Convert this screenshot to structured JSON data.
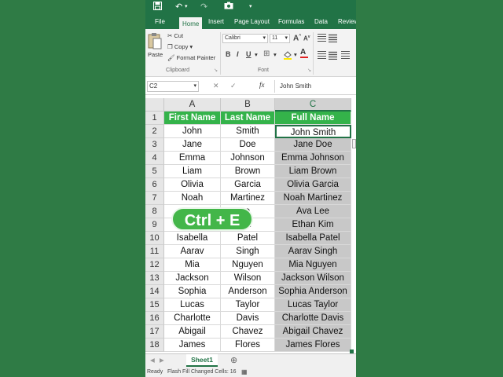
{
  "quick_access": {
    "save_icon": "save-icon",
    "undo_icon": "undo-icon",
    "redo_icon": "redo-icon",
    "camera_icon": "camera-icon"
  },
  "tabs": [
    "File",
    "Home",
    "Insert",
    "Page Layout",
    "Formulas",
    "Data",
    "Review"
  ],
  "active_tab": "Home",
  "ribbon": {
    "paste_label": "Paste",
    "cut_label": "Cut",
    "copy_label": "Copy",
    "format_painter_label": "Format Painter",
    "clipboard_group": "Clipboard",
    "font_name": "Calibri",
    "font_size": "11",
    "grow_font": "A",
    "shrink_font": "A",
    "bold": "B",
    "italic": "I",
    "underline": "U",
    "font_group": "Font"
  },
  "formula_bar": {
    "name_box": "C2",
    "fx": "fx",
    "value": "John Smith"
  },
  "columns": [
    "A",
    "B",
    "C"
  ],
  "header_row": [
    "First Name",
    "Last Name",
    "Full Name"
  ],
  "rows": [
    [
      "John",
      "Smith",
      "John Smith"
    ],
    [
      "Jane",
      "Doe",
      "Jane Doe"
    ],
    [
      "Emma",
      "Johnson",
      "Emma Johnson"
    ],
    [
      "Liam",
      "Brown",
      "Liam Brown"
    ],
    [
      "Olivia",
      "Garcia",
      "Olivia Garcia"
    ],
    [
      "Noah",
      "Martinez",
      "Noah Martinez"
    ],
    [
      "",
      "e",
      "Ava Lee"
    ],
    [
      "",
      "m",
      "Ethan Kim"
    ],
    [
      "Isabella",
      "Patel",
      "Isabella Patel"
    ],
    [
      "Aarav",
      "Singh",
      "Aarav Singh"
    ],
    [
      "Mia",
      "Nguyen",
      "Mia Nguyen"
    ],
    [
      "Jackson",
      "Wilson",
      "Jackson Wilson"
    ],
    [
      "Sophia",
      "Anderson",
      "Sophia Anderson"
    ],
    [
      "Lucas",
      "Taylor",
      "Lucas Taylor"
    ],
    [
      "Charlotte",
      "Davis",
      "Charlotte Davis"
    ],
    [
      "Abigail",
      "Chavez",
      "Abigail Chavez"
    ],
    [
      "James",
      "Flores",
      "James Flores"
    ]
  ],
  "overlay": {
    "shortcut": "Ctrl + E"
  },
  "sheet_tab": "Sheet1",
  "add_sheet": "⊕",
  "status": {
    "ready": "Ready",
    "message": "Flash Fill Changed Cells: 16"
  },
  "colors": {
    "excel_green": "#217346",
    "header_green": "#34b34a",
    "fill_gray": "#c8c8c8",
    "background": "#2f7b45"
  }
}
